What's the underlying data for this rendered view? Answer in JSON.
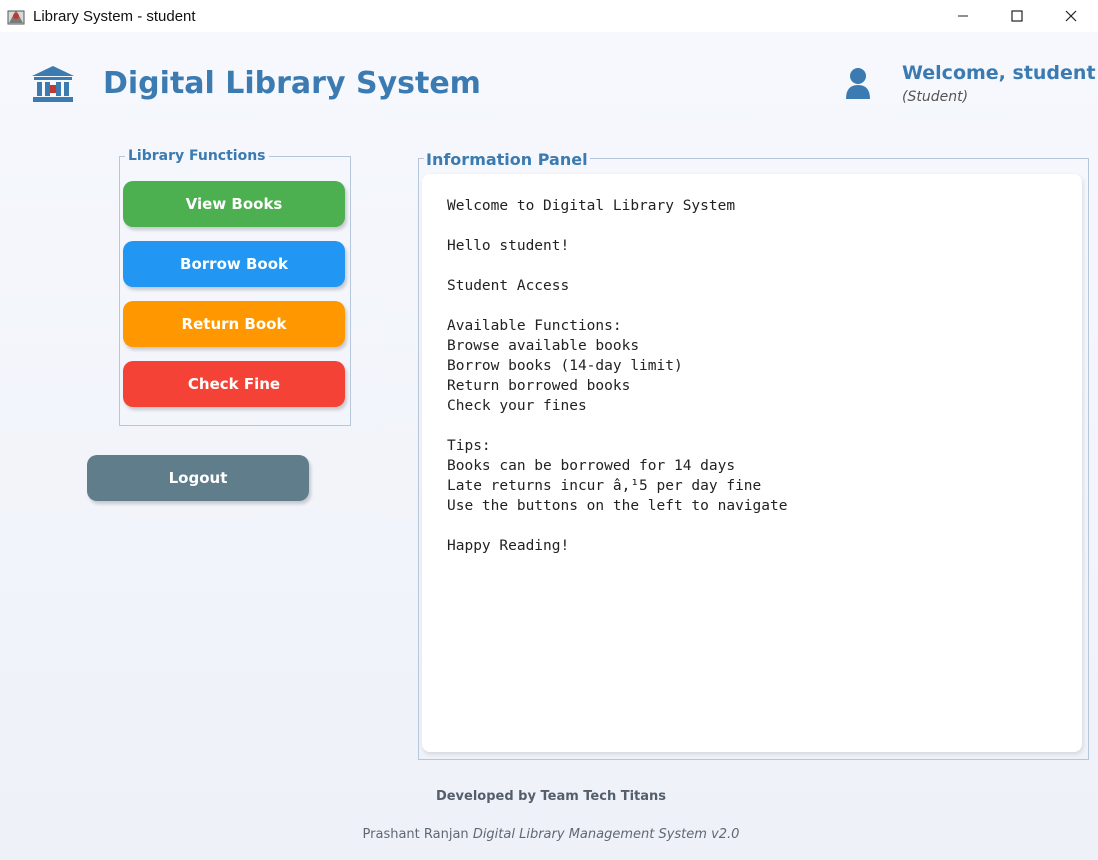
{
  "window": {
    "title": "Library System - student",
    "minimize_glyph": "—",
    "maximize_glyph": "☐",
    "close_glyph": "✕"
  },
  "header": {
    "logo_icon": "library-building-icon",
    "title": "Digital Library System",
    "user_icon": "user-icon",
    "welcome": "Welcome, student",
    "role": "(Student)"
  },
  "functions": {
    "legend": "Library Functions",
    "buttons": [
      {
        "label": "View Books",
        "color": "#4caf50"
      },
      {
        "label": "Borrow Book",
        "color": "#2196f3"
      },
      {
        "label": "Return Book",
        "color": "#ff9800"
      },
      {
        "label": "Check Fine",
        "color": "#f44336"
      }
    ],
    "logout": {
      "label": "Logout",
      "color": "#607d8b"
    }
  },
  "info_panel": {
    "legend": "Information Panel",
    "lines": [
      "Welcome to Digital Library System",
      "",
      "Hello student!",
      "",
      "Student Access",
      "",
      "Available Functions:",
      "Browse available books",
      "Borrow books (14-day limit)",
      "Return borrowed books",
      "Check your fines",
      "",
      "Tips:",
      "Books can be borrowed for 14 days",
      "Late returns incur â‚¹5 per day fine",
      "Use the buttons on the left to navigate",
      "",
      "Happy Reading!"
    ]
  },
  "footer": {
    "developed_by": "Developed by Team Tech Titans",
    "author": "Prashant Ranjan",
    "system_name": "Digital Library Management System v2.0"
  },
  "colors": {
    "accent": "#3b7bb1",
    "background": "#f3f5fb"
  }
}
